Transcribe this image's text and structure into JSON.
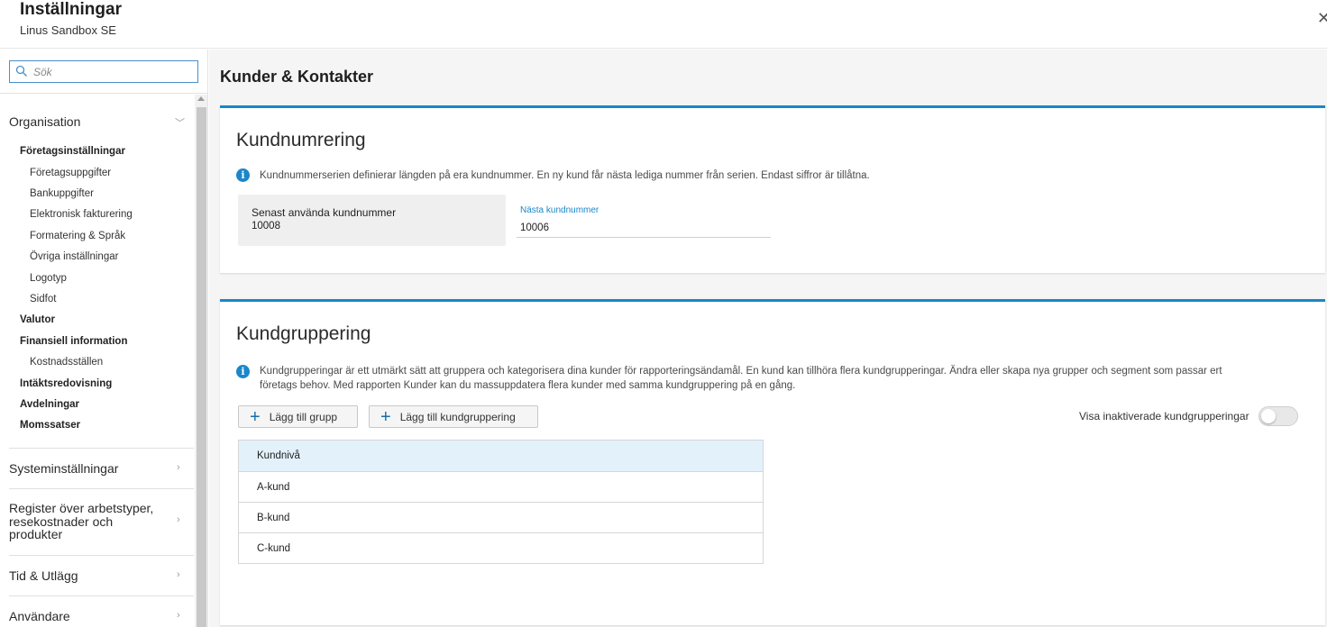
{
  "header": {
    "title": "Inställningar",
    "subtitle": "Linus Sandbox SE",
    "close": "✕"
  },
  "sidebar": {
    "search_placeholder": "Sök",
    "sections": {
      "organisation": "Organisation",
      "system": "Systeminställningar",
      "register": "Register över arbetstyper, resekostnader och produkter",
      "tid": "Tid & Utlägg",
      "anvandare": "Användare"
    },
    "org_items": {
      "foretagsinst": "Företagsinställningar",
      "foretagsuppgifter": "Företagsuppgifter",
      "bankuppgifter": "Bankuppgifter",
      "elfakt": "Elektronisk fakturering",
      "formatering": "Formatering & Språk",
      "ovriga": "Övriga inställningar",
      "logotyp": "Logotyp",
      "sidfot": "Sidfot",
      "valutor": "Valutor",
      "finansiell": "Finansiell information",
      "kostnad": "Kostnadsställen",
      "intakt": "Intäktsredovisning",
      "avdelningar": "Avdelningar",
      "moms": "Momssatser"
    }
  },
  "main": {
    "page_title": "Kunder & Kontakter",
    "kundnumrering": {
      "title": "Kundnumrering",
      "info": "Kundnummerserien definierar längden på era kundnummer. En ny kund får nästa lediga nummer från serien. Endast siffror är tillåtna.",
      "last_used_label": "Senast använda kundnummer",
      "last_used_value": "10008",
      "next_label": "Nästa kundnummer",
      "next_value": "10006"
    },
    "kundgruppering": {
      "title": "Kundgruppering",
      "info_line1": "Kundgrupperingar är ett utmärkt sätt att gruppera och kategorisera dina kunder för rapporteringsändamål. En kund kan tillhöra flera kundgrupperingar. Ändra eller skapa nya grupper och segment som passar ert",
      "info_line2": "företags behov. Med rapporten Kunder kan du massuppdatera flera kunder med samma kundgruppering på en gång.",
      "add_group": "Lägg till grupp",
      "add_grouping": "Lägg till kundgruppering",
      "show_inactive": "Visa inaktiverade kundgrupperingar",
      "show_inactive_on": false,
      "rows": [
        "Kundnivå",
        "A-kund",
        "B-kund",
        "C-kund"
      ]
    }
  }
}
